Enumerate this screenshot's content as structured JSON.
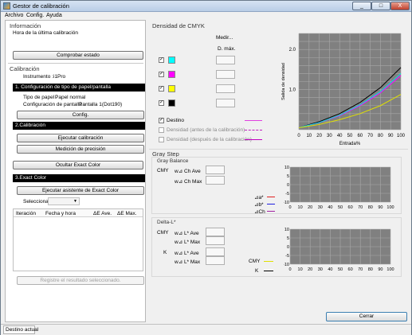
{
  "window": {
    "title": "Gestor de calibración",
    "minimize": "_",
    "maximize": "□",
    "close": "X"
  },
  "menu": [
    "Archivo",
    "Config.",
    "Ayuda"
  ],
  "info": {
    "heading": "Información",
    "last_calibration_label": "Hora de la última calibración",
    "check_button": "Comprobar estado"
  },
  "calibration": {
    "heading": "Calibración",
    "instrument_label": "Instrumento :",
    "instrument_value": "i1Pro",
    "step1": "1. Configuración de tipo de papel/pantalla",
    "paper_type_label": "Tipo de papel :",
    "paper_type_value": "Papel normal",
    "screen_config_label": "Configuración de pantalla :",
    "screen_config_value": "Pantalla 1(Dot190)",
    "config_button": "Config.",
    "step2": "2.Calibración",
    "run_button": "Ejecutar calibración",
    "measure_button": "Medición de precisión",
    "hide_exact_button": "Ocultar Exact Color",
    "step3": "3.Exact Color",
    "exact_wizard_button": "Ejecutar asistente de Exact Color",
    "select_label": "Seleccionar",
    "table_headers": [
      "Iteración",
      "Fecha y hora",
      "ΔE Ave.",
      "ΔE Max."
    ],
    "register_button": "Registre el resultado seleccionado."
  },
  "cmyk_density": {
    "heading": "Densidad de CMYK",
    "measure_label": "Medir...",
    "dmax_label": "D. máx.",
    "swatch_colors": [
      "#00ffff",
      "#ff00ff",
      "#ffff00",
      "#000000"
    ],
    "legend": [
      {
        "label": "Destino",
        "color": "#e040e0",
        "style": "solid",
        "checked": true
      },
      {
        "label": "Densidad (antes de la calibración)",
        "color": "#c020c0",
        "style": "dashed",
        "checked": false
      },
      {
        "label": "Densidad (después de la calibración)",
        "color": "#c000c0",
        "style": "solid",
        "checked": false
      }
    ]
  },
  "chart_data": {
    "type": "line",
    "ylabel": "Salida de densidad",
    "xlabel": "Entrada%",
    "x_ticks": [
      "0",
      "10",
      "20",
      "30",
      "40",
      "50",
      "60",
      "70",
      "80",
      "90",
      "100"
    ],
    "y_ticks": [
      "2.0",
      "1.0"
    ],
    "xlim": [
      0,
      100
    ],
    "ylim": [
      0,
      2.4
    ],
    "grid": true,
    "series": [
      {
        "color": "#000000",
        "x": [
          0,
          20,
          40,
          60,
          80,
          100
        ],
        "y": [
          0.05,
          0.2,
          0.4,
          0.68,
          1.05,
          1.55
        ]
      },
      {
        "color": "#ff00ff",
        "x": [
          0,
          20,
          40,
          60,
          80,
          100
        ],
        "y": [
          0.05,
          0.18,
          0.35,
          0.6,
          0.92,
          1.35
        ]
      },
      {
        "color": "#00e0e0",
        "x": [
          0,
          20,
          40,
          60,
          80,
          100
        ],
        "y": [
          0.05,
          0.18,
          0.36,
          0.62,
          0.95,
          1.4
        ]
      },
      {
        "color": "#e0e000",
        "x": [
          0,
          20,
          40,
          60,
          80,
          100
        ],
        "y": [
          0.05,
          0.13,
          0.25,
          0.4,
          0.6,
          0.88
        ]
      }
    ]
  },
  "gray_step": {
    "heading": "Gray Step",
    "gray_balance": "Gray Balance",
    "cmy_label": "CMY",
    "ch_ave": "w⊿ Ch Ave",
    "ch_max": "w⊿ Ch Max",
    "legend": [
      {
        "label": "⊿a*",
        "color": "#e02020"
      },
      {
        "label": "⊿b*",
        "color": "#2020e0"
      },
      {
        "label": "⊿Ch",
        "color": "#a020a0"
      }
    ],
    "y_ticks": [
      "10",
      "5",
      "0",
      "-5",
      "-10"
    ],
    "x_ticks": [
      "0",
      "10",
      "20",
      "30",
      "40",
      "50",
      "60",
      "70",
      "80",
      "90",
      "100"
    ],
    "delta_l": "Delta-L*",
    "cmy_label2": "CMY",
    "l_ave": "w⊿ L* Ave",
    "l_max": "w⊿ L* Max",
    "k_label": "K",
    "l_ave_k": "w⊿ L* Ave",
    "l_max_k": "w⊿ L* Max",
    "legend2": [
      {
        "label": "CMY",
        "color": "#e0e000"
      },
      {
        "label": "K",
        "color": "#000000"
      }
    ]
  },
  "close_button": "Cerrar",
  "status": "Destino actual"
}
